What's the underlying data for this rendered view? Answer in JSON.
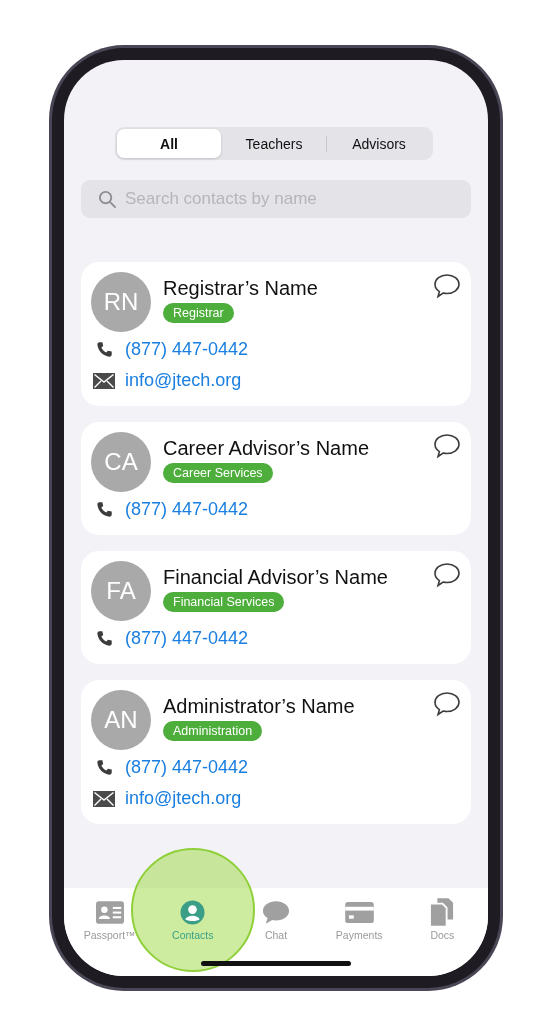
{
  "segments": [
    {
      "label": "All",
      "selected": true
    },
    {
      "label": "Teachers",
      "selected": false
    },
    {
      "label": "Advisors",
      "selected": false
    }
  ],
  "search": {
    "placeholder": "Search contacts by name"
  },
  "contacts": [
    {
      "initials": "RN",
      "name": "Registrar’s Name",
      "tag": "Registrar",
      "phone": "(877) 447-0442",
      "email": "info@jtech.org"
    },
    {
      "initials": "CA",
      "name": "Career Advisor’s Name",
      "tag": "Career Services",
      "phone": "(877) 447-0442"
    },
    {
      "initials": "FA",
      "name": "Financial Advisor’s Name",
      "tag": "Financial Services",
      "phone": "(877) 447-0442"
    },
    {
      "initials": "AN",
      "name": "Administrator’s Name",
      "tag": "Administration",
      "phone": "(877) 447-0442",
      "email": "info@jtech.org"
    }
  ],
  "tab_bar": [
    {
      "kind": "passport",
      "label": "Passport™",
      "selected": false,
      "touched": false
    },
    {
      "kind": "contacts",
      "label": "Contacts",
      "selected": true,
      "touched": true
    },
    {
      "kind": "chat",
      "label": "Chat",
      "selected": false,
      "touched": false
    },
    {
      "kind": "payments",
      "label": "Payments",
      "selected": false,
      "touched": false
    },
    {
      "kind": "docs",
      "label": "Docs",
      "selected": false,
      "touched": false
    }
  ]
}
